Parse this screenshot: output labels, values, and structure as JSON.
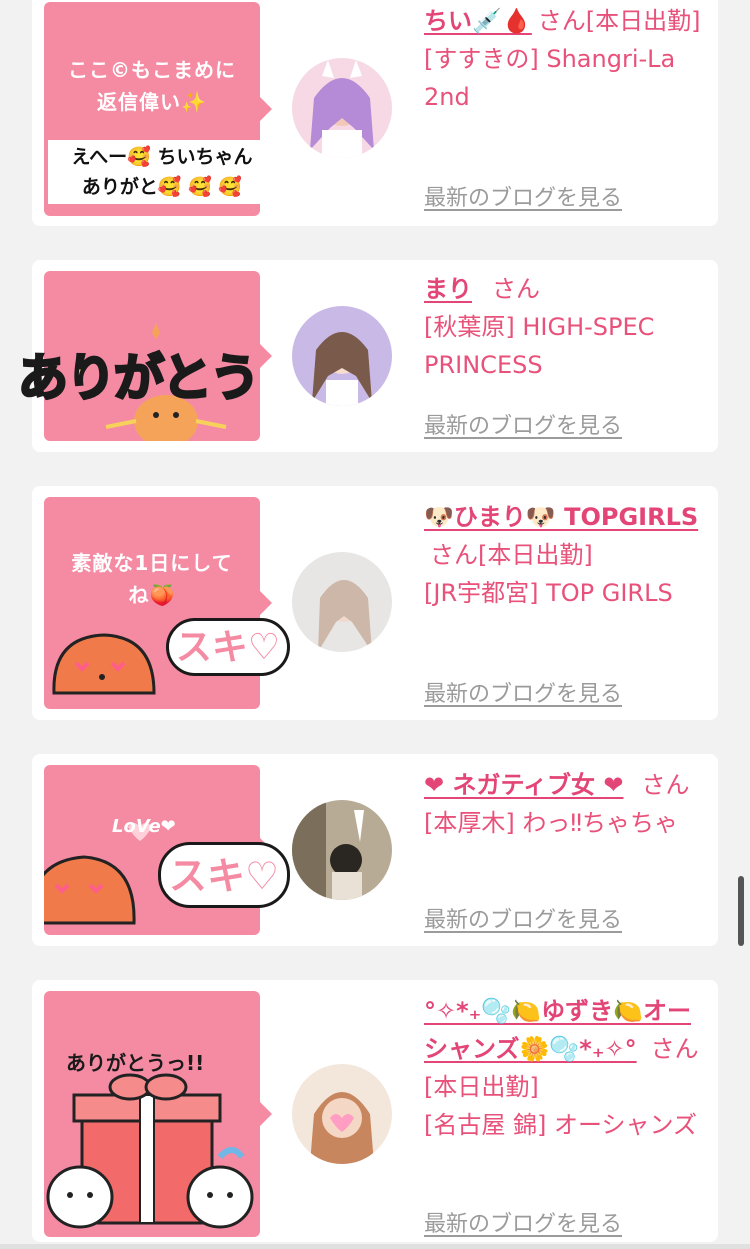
{
  "cards": [
    {
      "message_lines": [
        "ここ©もこまめに",
        "返信偉い✨"
      ],
      "reply_lines": [
        "えへー🥰 ちいちゃん",
        "ありがと🥰 🥰 🥰"
      ],
      "name": "ちい💉🩸",
      "honorific": "さん[本日出勤]",
      "shop": "[すすきの] Shangri-La 2nd",
      "blog_link": "最新のブログを見る"
    },
    {
      "sticker_text": "ありがとう",
      "name": "まり",
      "honorific": "さん",
      "shop": "[秋葉原] HIGH-SPEC PRINCESS",
      "blog_link": "最新のブログを見る"
    },
    {
      "message_lines": [
        "素敵な1日にして",
        "ね🍑"
      ],
      "sticker_text": "スキ♡",
      "name": "🐶ひまり🐶 TOPGIRLS",
      "honorific": "さん[本日出勤]",
      "shop": "[JR宇都宮] TOP GIRLS",
      "blog_link": "最新のブログを見る"
    },
    {
      "sticker_love": "LoVe❤",
      "sticker_text": "スキ♡",
      "name": "❤ ネガティブ女 ❤",
      "honorific": "さん",
      "shop": "[本厚木] わっ‼ちゃちゃ",
      "blog_link": "最新のブログを見る"
    },
    {
      "sticker_text": "ありがとうっ!!",
      "name": "°✧*₊🫧🍋ゆずき🍋オーシャンズ🌼🫧*₊✧°",
      "honorific": "さん[本日出勤]",
      "shop": "[名古屋 錦] オーシャンズ",
      "blog_link": "最新のブログを見る"
    }
  ],
  "colors": {
    "accent": "#e34576",
    "bubble": "#f48ba3",
    "link_gray": "#9b9b9b",
    "background": "#f2f2f2"
  }
}
